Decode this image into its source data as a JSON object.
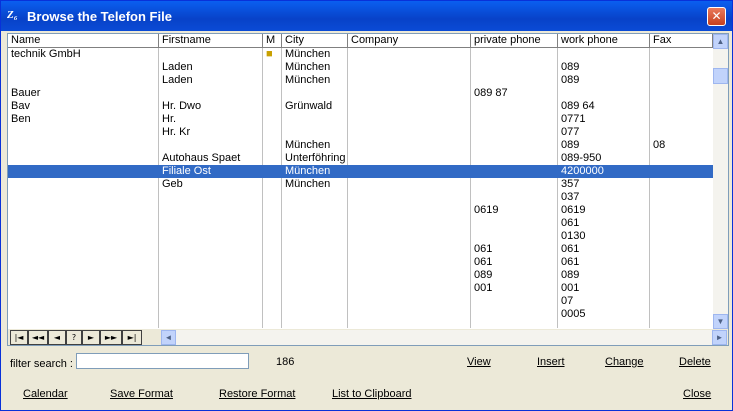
{
  "window": {
    "title": "Browse the Telefon File",
    "icon": "Z₆",
    "close_symbol": "✕"
  },
  "columns": [
    {
      "key": "name",
      "label": "Name"
    },
    {
      "key": "firstname",
      "label": "Firstname"
    },
    {
      "key": "m",
      "label": "M"
    },
    {
      "key": "city",
      "label": "City"
    },
    {
      "key": "company",
      "label": "Company"
    },
    {
      "key": "private_phone",
      "label": "private phone"
    },
    {
      "key": "work_phone",
      "label": "work phone"
    },
    {
      "key": "fax",
      "label": "Fax"
    }
  ],
  "rows": [
    {
      "name": "technik GmbH",
      "firstname": "",
      "m": "■",
      "city": "München",
      "company": "",
      "private_phone": "",
      "work_phone": "",
      "fax": ""
    },
    {
      "name": "",
      "firstname": "Laden",
      "m": "",
      "city": "München",
      "company": "",
      "private_phone": "",
      "work_phone": "089",
      "fax": ""
    },
    {
      "name": "",
      "firstname": "Laden",
      "m": "",
      "city": "München",
      "company": "",
      "private_phone": "",
      "work_phone": "089",
      "fax": ""
    },
    {
      "name": "Bauer",
      "firstname": "",
      "m": "",
      "city": "",
      "company": "",
      "private_phone": "089 87",
      "work_phone": "",
      "fax": ""
    },
    {
      "name": "Bav",
      "firstname": "Hr. Dwo",
      "m": "",
      "city": "Grünwald",
      "company": "",
      "private_phone": "",
      "work_phone": "089 64",
      "fax": ""
    },
    {
      "name": "Ben",
      "firstname": "Hr.",
      "m": "",
      "city": "",
      "company": "",
      "private_phone": "",
      "work_phone": "0771",
      "fax": ""
    },
    {
      "name": "",
      "firstname": "Hr. Kr",
      "m": "",
      "city": "",
      "company": "",
      "private_phone": "",
      "work_phone": "077",
      "fax": ""
    },
    {
      "name": "",
      "firstname": "",
      "m": "",
      "city": "München",
      "company": "",
      "private_phone": "",
      "work_phone": "089",
      "fax": "08"
    },
    {
      "name": "",
      "firstname": "Autohaus Spaet",
      "m": "",
      "city": "Unterföhring",
      "company": "",
      "private_phone": "",
      "work_phone": "089-950",
      "fax": ""
    },
    {
      "name": "",
      "firstname": "Filiale Ost",
      "m": "",
      "city": "München",
      "company": "",
      "private_phone": "",
      "work_phone": "4200000",
      "fax": ""
    },
    {
      "name": "",
      "firstname": "Geb",
      "m": "",
      "city": "München",
      "company": "",
      "private_phone": "",
      "work_phone": "357",
      "fax": ""
    },
    {
      "name": "",
      "firstname": "",
      "m": "",
      "city": "",
      "company": "",
      "private_phone": "",
      "work_phone": "037",
      "fax": ""
    },
    {
      "name": "",
      "firstname": "",
      "m": "",
      "city": "",
      "company": "",
      "private_phone": "0619",
      "work_phone": "0619",
      "fax": ""
    },
    {
      "name": "",
      "firstname": "",
      "m": "",
      "city": "",
      "company": "",
      "private_phone": "",
      "work_phone": "061",
      "fax": ""
    },
    {
      "name": "",
      "firstname": "",
      "m": "",
      "city": "",
      "company": "",
      "private_phone": "",
      "work_phone": "0130",
      "fax": ""
    },
    {
      "name": "",
      "firstname": "",
      "m": "",
      "city": "",
      "company": "",
      "private_phone": "061",
      "work_phone": "061",
      "fax": ""
    },
    {
      "name": "",
      "firstname": "",
      "m": "",
      "city": "",
      "company": "",
      "private_phone": "061",
      "work_phone": "061",
      "fax": ""
    },
    {
      "name": "",
      "firstname": "",
      "m": "",
      "city": "",
      "company": "",
      "private_phone": "089",
      "work_phone": "089",
      "fax": ""
    },
    {
      "name": "",
      "firstname": "",
      "m": "",
      "city": "",
      "company": "",
      "private_phone": "001",
      "work_phone": "001",
      "fax": ""
    },
    {
      "name": "",
      "firstname": "",
      "m": "",
      "city": "",
      "company": "",
      "private_phone": "",
      "work_phone": "07",
      "fax": ""
    },
    {
      "name": "",
      "firstname": "",
      "m": "",
      "city": "",
      "company": "",
      "private_phone": "",
      "work_phone": "0005",
      "fax": ""
    }
  ],
  "selected_row": 9,
  "navigator": [
    "|◄",
    "◄◄",
    "◄",
    "?",
    "►",
    "►►",
    "►|"
  ],
  "scroll": {
    "up": "▲",
    "down": "▼",
    "left": "◄",
    "right": "►"
  },
  "filter": {
    "label": "filter search :",
    "value": "",
    "count": "186"
  },
  "actions": {
    "view": "View",
    "insert": "Insert",
    "change": "Change",
    "delete": "Delete"
  },
  "footer": {
    "calendar": "Calendar",
    "save_format": "Save Format",
    "restore_format": "Restore Format",
    "list_to_clipboard": "List to Clipboard",
    "close": "Close"
  },
  "colors": {
    "titlebar": "#0A5FF0",
    "selection": "#316AC5",
    "background": "#ECE9D8"
  }
}
